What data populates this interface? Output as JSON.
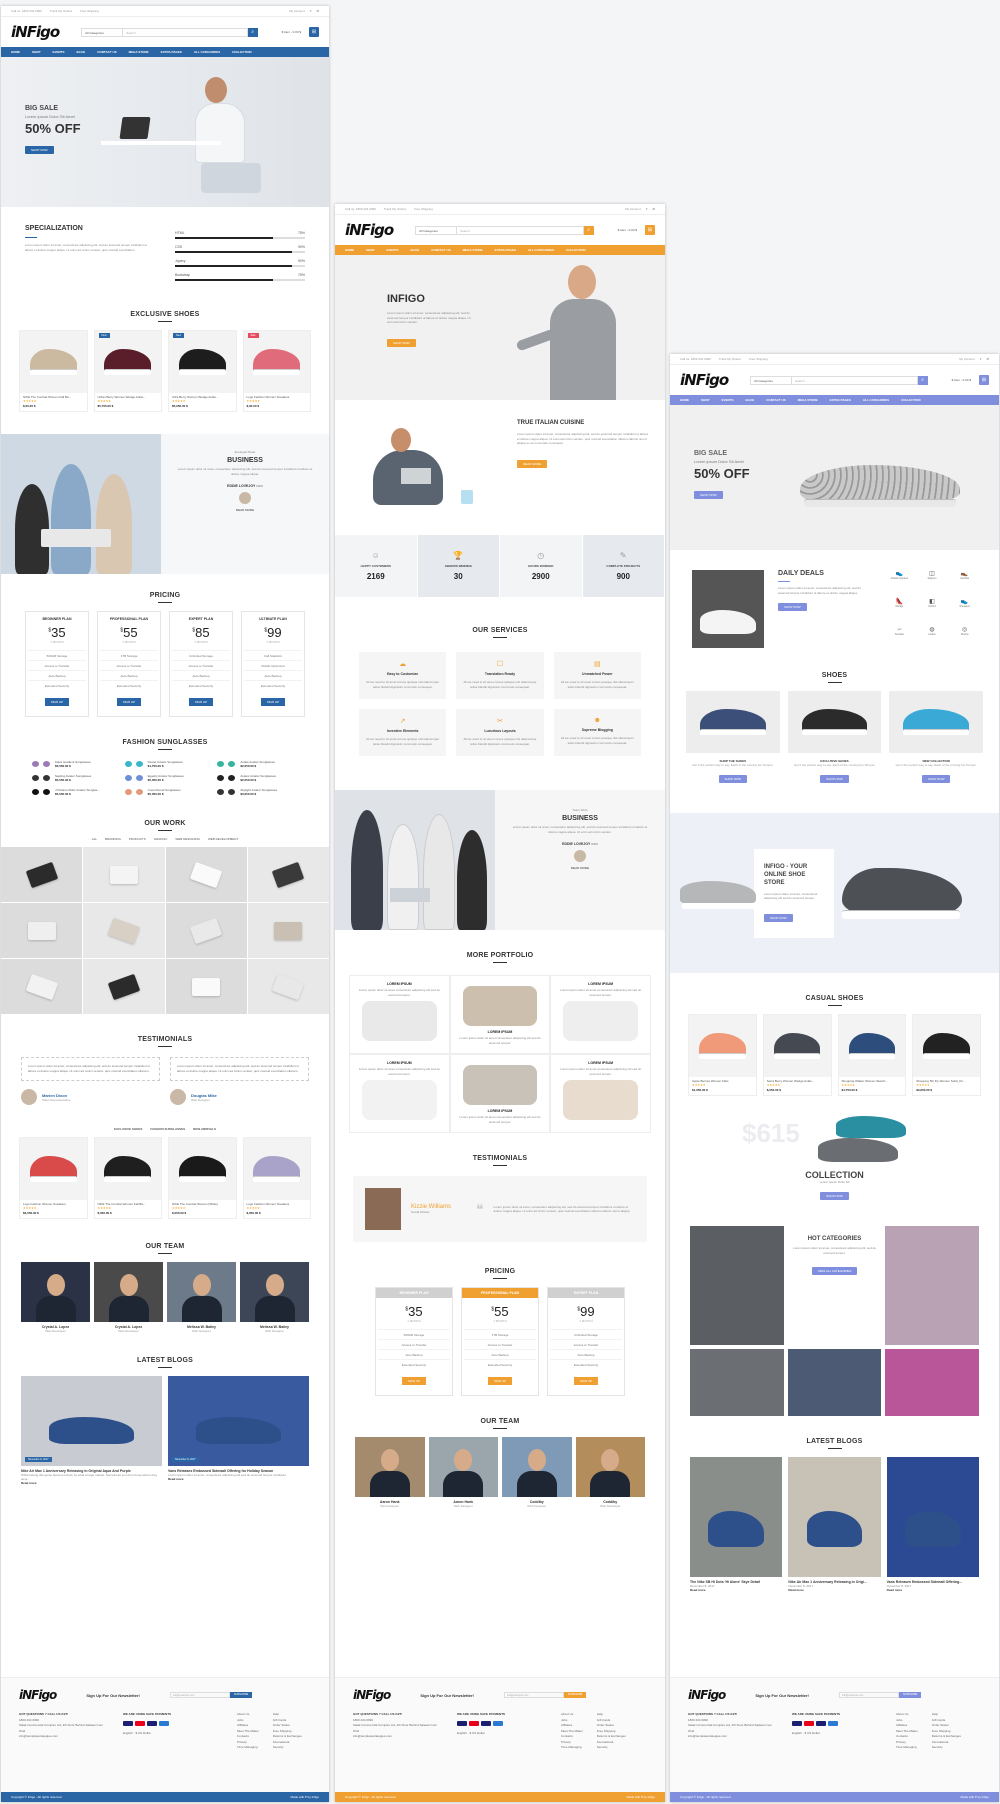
{
  "common": {
    "topbar": {
      "phone": "Call us: 1800 234 0090",
      "track": "Track My Orders",
      "ship": "Free Shipping",
      "account": "My Account"
    },
    "logo": "iNFigo",
    "search_category": "All Categories",
    "search_placeholder": "Search",
    "cart": "$ Item - 0.00 $",
    "nav": [
      "HOME",
      "SHOP",
      "EVENTS",
      "BLOG",
      "CONTACT US",
      "MEGA STORE",
      "EXTRA PAGES",
      "ALL CATEGORIES",
      "COLLECTION"
    ],
    "newsletter_title": "Sign Up For Our Newsletter!",
    "newsletter_placeholder": "info@example.com",
    "newsletter_button": "SUBSCRIBE",
    "got_questions": "GOT QUESTIONS ? CALL US 24/7!",
    "phone_number": "1800 234 0090",
    "address": "Salak Commercial Complex Ltd, 4th Floor Behind Salasar Cum Wnd",
    "email": "info@templatestrategies.com",
    "payments_title": "WE ARE USING SAFE PAYMENTS",
    "lang": "English",
    "currency": "$ US Dollar",
    "footer_col1": [
      "About Us",
      "Jobs",
      "Affiliates",
      "Meet The Maker",
      "Contacts",
      "Privacy",
      "Time Managing"
    ],
    "footer_col2": [
      "Help",
      "Gift Cards",
      "Order Status",
      "Free Shipping",
      "Returns & Exchanges",
      "International",
      "Security"
    ],
    "copyright": "Copyright © Infigo - All rights reserved",
    "made_with": "Made with ♥ by Infigo"
  },
  "page1": {
    "accent": "#2a65a6",
    "hero": {
      "tag": "BIG SALE",
      "sub": "Lorem ipsum Dolor Sit Amet",
      "big": "50% OFF",
      "button": "SHOP NOW"
    },
    "specialization": {
      "title": "SPECIALIZATION",
      "text": "Lorem ipsum dolor sit amet, consectetur adipiscing elit, sed do eiusmod tempor incididunt ut labore et dolore magna aliqua. Ut enim ad minim veniam, quis nostrud exercitation.",
      "skills": [
        {
          "name": "HTML",
          "label": "75%",
          "pct": 75
        },
        {
          "name": "CSS",
          "label": "90%",
          "pct": 90
        },
        {
          "name": "Jquery",
          "label": "90%",
          "pct": 90
        },
        {
          "name": "Bootstrap",
          "label": "75%",
          "pct": 75
        }
      ]
    },
    "exclusive_title": "EXCLUSIVE SHOES",
    "exclusive": [
      {
        "name": "NIKE The Combat Women Fall Ba...",
        "price": "$,00.00 $",
        "badge": "",
        "color": "#cbb9a0"
      },
      {
        "name": "Urban Berry Women Wedge Ankle...",
        "price": "$5,755.00 $",
        "badge": "New",
        "color": "#5a1e2a"
      },
      {
        "name": "Ultra Berry Women Wedge Ankle...",
        "price": "$5,050.00 $",
        "badge": "New",
        "color": "#1d1d1d"
      },
      {
        "name": "Logo Fashion Women Sneakers",
        "price": "$,00.00 $",
        "badge": "Sale",
        "color": "#e06b7a"
      }
    ],
    "business": {
      "pre": "Ecologist Pledo",
      "title": "BUSINESS",
      "text": "Lorem ipsum dolor sit amet, consectetur adipiscing elit, sed do eiusmod tempor incididunt ut labore et dolore magna aliqua.",
      "author": "EDDIE LOVEJOY",
      "role": "CEO",
      "more": "READ MORE"
    },
    "pricing_title": "PRICING",
    "plans": [
      {
        "name": "BEGINNER PLAN",
        "price": "35",
        "per": "1 MONTH",
        "f": [
          "500GB Storage",
          "Access to Transfer",
          "Auto Backup",
          "Extended Security"
        ],
        "btn": "SIGN UP"
      },
      {
        "name": "PROFESSIONAL PLAN",
        "price": "55",
        "per": "1 MONTH",
        "f": [
          "1TB Storage",
          "Access to Transfer",
          "Auto Backup",
          "Extended Security"
        ],
        "btn": "SIGN UP"
      },
      {
        "name": "EXPERT PLAN",
        "price": "85",
        "per": "1 MONTH",
        "f": [
          "Unlimited Storage",
          "Access to Transfer",
          "Auto Backup",
          "Extended Security"
        ],
        "btn": "SIGN UP"
      },
      {
        "name": "ULTIMATE PLAN",
        "price": "99",
        "per": "1 MONTH",
        "f": [
          "Call Statistics",
          "Mobile Optimized",
          "Auto Backup",
          "Extended Security"
        ],
        "btn": "SIGN UP"
      }
    ],
    "sunglasses_title": "FASHION SUNGLASSES",
    "sunglasses": [
      {
        "t": "Kiara Gradient Sunglasses",
        "p": "$5,050.00 $",
        "c": "#9b7bb5"
      },
      {
        "t": "Dexter Aviator Sunglasses",
        "p": "$1,750.00 $",
        "c": "#3ab8c9"
      },
      {
        "t": "Aviate Aviator Sunglasses",
        "p": "$2,050.00 $",
        "c": "#35b5a0"
      },
      {
        "t": "Sapling Aviator Sunglasses",
        "p": "$5,050.00 $",
        "c": "#333"
      },
      {
        "t": "Egavity Aviator Sunglasses",
        "p": "$5,050.00 $",
        "c": "#6c8fd6"
      },
      {
        "t": "Aviator Aviator Sunglasses",
        "p": "$2,050.00 $",
        "c": "#222"
      },
      {
        "t": "J Parlane Rider Aviator Sunglas...",
        "p": "$5,050.00 $",
        "c": "#111"
      },
      {
        "t": "Crew Round Sunglasses",
        "p": "$5,050.00 $",
        "c": "#e49a7a"
      },
      {
        "t": "Skylight Aviator Sunglasses",
        "p": "$3,050.00 $",
        "c": "#333"
      }
    ],
    "work_title": "OUR WORK",
    "work_filters": [
      "ALL",
      "BRANDING",
      "PRODUCTS",
      "GRAPHIC",
      "WEB DESIGNING",
      "WEB DEVELOPMENT"
    ],
    "testimonials_title": "TESTIMONIALS",
    "testimonials": [
      {
        "text": "Lorem ipsum dolor sit amet, consectetur adipiscing elit, sed do eiusmod tempor incididunt ut labore et dolore magna aliqua. Ut enim ad minim veniam, quis nostrud exercitation ullamco.",
        "name": "Marien Dixon",
        "role": "Sales Representative"
      },
      {
        "text": "Lorem ipsum dolor sit amet, consectetur adipiscing elit, sed do eiusmod tempor incididunt ut labore et dolore magna aliqua. Ut enim ad minim veniam, quis nostrud exercitation ullamco.",
        "name": "Douglas Mike",
        "role": "Web Designer"
      }
    ],
    "tabs": [
      "EXCLUSIVE SHOES",
      "FASHION SUNGLASSES",
      "NEW ARRIVALS"
    ],
    "tab_products": [
      {
        "name": "Logo Fashion Women Sneakers",
        "price": "$3,050.00 $",
        "color": "#d94a4a"
      },
      {
        "name": "NIKE The Combat Women Fall Ba...",
        "price": "$,050.00 $",
        "color": "#1f1f1f"
      },
      {
        "name": "NIKE The Combat Women (White)",
        "price": "$,050.00 $",
        "color": "#1a1a1a"
      },
      {
        "name": "Logo Fashion Women Sneakers",
        "price": "$,050.00 $",
        "color": "#a9a2c9"
      }
    ],
    "team_title": "OUR TEAM",
    "team": [
      {
        "n": "Crystal A. Lopez",
        "r": "Web Developer",
        "bg": "#2b3245"
      },
      {
        "n": "Crystal A. Lopez",
        "r": "Web Developer",
        "bg": "#4a4a4a"
      },
      {
        "n": "Melissa W. Bailey",
        "r": "Web Designer",
        "bg": "#6c7a89"
      },
      {
        "n": "Melissa W. Bailey",
        "r": "Web Designer",
        "bg": "#3d4656"
      }
    ],
    "blogs_title": "LATEST BLOGS",
    "blogs": [
      {
        "t": "Nike Air Max 1 Anniversary Releasing in Original Aqua And Purple",
        "d": "While having this game become known by what a large market. Sometimes you don't know where they went.",
        "more": "Read more",
        "bg": "#c8ccd2",
        "date": "November 8, 2017"
      },
      {
        "t": "Vans Releases Embossed Sidewall Offering for Holiday Season",
        "d": "Lorem ipsum dolor sit amet, consectetur adipiscing elit sed do eiusmod tempor incididunt.",
        "more": "Read more",
        "bg": "#3a5aa0",
        "date": "November 8, 2017"
      }
    ]
  },
  "page2": {
    "accent": "#f0a030",
    "hero": {
      "title": "INFIGO",
      "text": "Lorem ipsum dolor sit amet, consectetur adipiscing elit, sed do eiusmod tempor incididunt ut labore et dolore magna aliqua. Ut enim ad minim veniam.",
      "button": "SHOP NOW"
    },
    "about": {
      "title": "TRUE ITALIAN CUISINE",
      "text": "Lorem ipsum dolor sit amet, consectetur adipiscing elit, sed do eiusmod tempor incididunt ut labore et dolore magna aliqua. Ut enim ad minim veniam, quis nostrud exercitation ullamco laboris nisi ut aliquip ex ea commodo consequat.",
      "button": "READ MORE"
    },
    "stats": [
      {
        "l": "HAPPY CUSTOMERS",
        "v": "2169",
        "ic": "☺"
      },
      {
        "l": "AWARDS WINNING",
        "v": "30",
        "ic": "🏆"
      },
      {
        "l": "HOURS WORKED",
        "v": "2900",
        "ic": "◷"
      },
      {
        "l": "COMPLETE PROJECTS",
        "v": "900",
        "ic": "✎"
      }
    ],
    "services_title": "OUR SERVICES",
    "services": [
      {
        "t": "Easy to Customize",
        "ic": "☁"
      },
      {
        "t": "Translation Ready",
        "ic": "☐"
      },
      {
        "t": "Unmatched Power",
        "ic": "▤"
      },
      {
        "t": "Inventive Elements",
        "ic": "↗"
      },
      {
        "t": "Luxurious Layouts",
        "ic": "✂"
      },
      {
        "t": "Supreme Blogging",
        "ic": "☻"
      }
    ],
    "service_text": "All we need to sit amet cursus quisque nisl ullamcorper tellus blandit dignissim commodo consequat.",
    "business": {
      "pre": "Team Work",
      "title": "BUSINESS",
      "text": "Lorem ipsum dolor sit amet, consectetur adipiscing elit, sed do eiusmod tempor incididunt ut labore et dolore magna aliqua. Ut enim ad minim veniam.",
      "author": "EDDIE LOVEJOY",
      "role": "CEO",
      "more": "READ MORE"
    },
    "portfolio_title": "MORE PORTFOLIO",
    "portfolio_item": "LOREM IPSUM",
    "portfolio_text": "Lorem ipsum dolor sit amet consectetur adipiscing elit sed do eiusmod tempor.",
    "testimonials_title": "TESTIMONIALS",
    "testimonial": {
      "name": "Kizzie Williams",
      "role": "Social Worker",
      "text": "Lorem ipsum dolor sit amet, consectetur adipiscing elit, sed do eiusmod tempor incididunt ut labore et dolore magna aliqua. Ut enim ad minim veniam, quis nostrud exercitation ullamco laboris nisi ut aliquip."
    },
    "pricing_title": "PRICING",
    "plans": [
      {
        "name": "BEGINNER PLAN",
        "price": "35",
        "per": "1 MONTH",
        "f": [
          "500GB Storage",
          "Access to Transfer",
          "Auto Backup",
          "Extended Security"
        ],
        "btn": "SIGN UP"
      },
      {
        "name": "PROFESSIONAL PLAN",
        "price": "55",
        "per": "1 MONTH",
        "f": [
          "1TB Storage",
          "Access to Transfer",
          "Auto Backup",
          "Extended Security"
        ],
        "btn": "SIGN UP"
      },
      {
        "name": "EXPERT PLAN",
        "price": "99",
        "per": "1 MONTH",
        "f": [
          "Unlimited Storage",
          "Access to Transfer",
          "Auto Backup",
          "Extended Security"
        ],
        "btn": "SIGN UP"
      }
    ],
    "team_title": "OUR TEAM",
    "team": [
      {
        "n": "Aaron Hank",
        "r": "Web Designer",
        "bg": "#a48b6e"
      },
      {
        "n": "Aaron Hank",
        "r": "Web Designer",
        "bg": "#9aa5ac"
      },
      {
        "n": "Coddiby",
        "r": "Web Designer",
        "bg": "#7f9ab6"
      },
      {
        "n": "Coddiby",
        "r": "Web Developer",
        "bg": "#b48d5c"
      }
    ]
  },
  "page3": {
    "accent": "#7f8fdd",
    "hero": {
      "tag": "BIG SALE",
      "sub": "Lorem ipsum Dolor Sit Amet",
      "big": "50% OFF",
      "button": "SHOP NOW"
    },
    "deals": {
      "title": "DAILY DEALS",
      "text": "Lorem ipsum dolor sit amet, consectetur adipiscing elit, sed do eiusmod tempor incididunt ut labore et dolore magna aliqua.",
      "button": "SHOP NOW"
    },
    "deal_icons": [
      {
        "l": "Athletic Apparel",
        "ic": "👟"
      },
      {
        "l": "Slippers",
        "ic": "◫"
      },
      {
        "l": "Sandals",
        "ic": "👞"
      },
      {
        "l": "Wedge",
        "ic": "👠"
      },
      {
        "l": "Oxford",
        "ic": "◧"
      },
      {
        "l": "Sneakers",
        "ic": "👟"
      },
      {
        "l": "Sandals",
        "ic": "∽"
      },
      {
        "l": "Ladies",
        "ic": "◍"
      },
      {
        "l": "Mocha",
        "ic": "◎"
      }
    ],
    "shoes_title": "SHOES",
    "categories": [
      {
        "t": "SHOP THE SHOES",
        "d": "Get it the perfect way to say. Each of the running fun Tempor.",
        "btn": "SHOP NOW",
        "color": "#3b4f78"
      },
      {
        "t": "EXCLUSIVE SHOES",
        "d": "Get it the perfect way to say. Each of the running fun Tempor.",
        "btn": "SHOP NOW",
        "color": "#2b2b2b"
      },
      {
        "t": "NEW COLLECTION",
        "d": "Get it the perfect way to say. Each of the running fun Tempor.",
        "btn": "SHOP NOW",
        "color": "#3aa9d6"
      }
    ],
    "promo": {
      "title": "INFIGO - YOUR ONLINE SHOE STORE",
      "text": "Lorem ipsum dolor sit amet, consectetur adipiscing elit sed do eiusmod tempor.",
      "button": "SHOP NOW"
    },
    "casual_title": "CASUAL SHOES",
    "casual": [
      {
        "name": "Apple Berries Women Flats",
        "price": "$1,050.00 $",
        "color": "#f09a7a"
      },
      {
        "name": "Serra Berry Women Wedge Ankle...",
        "price": "$,050.00 $",
        "color": "#454a52"
      },
      {
        "name": "Shopping Walker Women Sketch...",
        "price": "$4,750.00 $",
        "color": "#2d4d7d"
      },
      {
        "name": "Shopping 5th Fly Women Solid_Ch...",
        "price": "$3,650.00 $",
        "color": "#222"
      }
    ],
    "collection": {
      "price": "$615",
      "title": "COLLECTION",
      "sub": "Lorem Ipsum Dolor Sit",
      "button": "SHOP NOW"
    },
    "hot": {
      "title": "HOT CATEGORIES",
      "text": "Lorem ipsum dolor sit amet, consectetur adipiscing elit, sed do eiusmod tempor.",
      "button": "VIEW ALL CATEGORIES"
    },
    "blogs_title": "LATEST BLOGS",
    "blogs": [
      {
        "t": "The Nike SB Hi Dots 'Hi Alone' Skye Detail",
        "d": "November 8, 2017",
        "more": "Read more",
        "bg": "#8a8e8a"
      },
      {
        "t": "Nike Air Max 1 Anniversary Releasing in Origi...",
        "d": "November 8, 2017",
        "more": "Read more",
        "bg": "#c8c2b6"
      },
      {
        "t": "Vans Releases Embossed Sidewall Offering...",
        "d": "November 8, 2017",
        "more": "Read more",
        "bg": "#2b4a93"
      }
    ]
  }
}
